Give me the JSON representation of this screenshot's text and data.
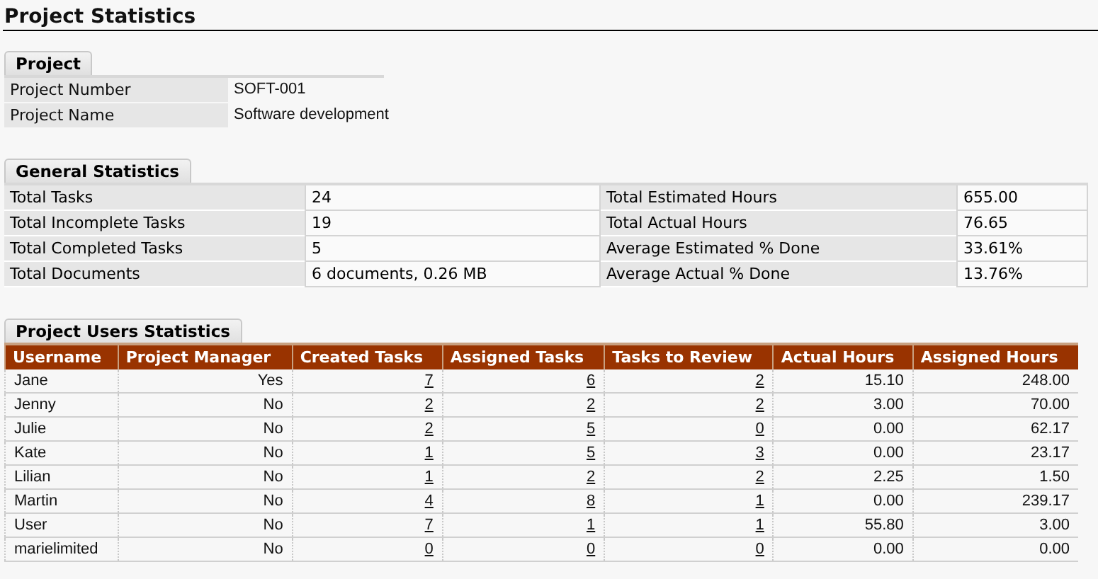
{
  "title": "Project Statistics",
  "project": {
    "tab": "Project",
    "rows": [
      {
        "label": "Project Number",
        "value": "SOFT-001"
      },
      {
        "label": "Project Name",
        "value": "Software development"
      }
    ]
  },
  "general": {
    "tab": "General Statistics",
    "rows": [
      {
        "label": "Total Tasks",
        "value": "24",
        "label_2": "Total Estimated Hours",
        "value_2": "655.00"
      },
      {
        "label": "Total Incomplete Tasks",
        "value": "19",
        "label_2": "Total Actual Hours",
        "value_2": "76.65"
      },
      {
        "label": "Total Completed Tasks",
        "value": "5",
        "label_2": "Average Estimated % Done",
        "value_2": "33.61%"
      },
      {
        "label": "Total Documents",
        "value": "6 documents, 0.26 MB",
        "label_2": "Average Actual % Done",
        "value_2": "13.76%"
      }
    ]
  },
  "users": {
    "tab": "Project Users Statistics",
    "columns": [
      {
        "label": "Username",
        "kind": "text"
      },
      {
        "label": "Project Manager",
        "kind": "flag"
      },
      {
        "label": "Created Tasks",
        "kind": "link"
      },
      {
        "label": "Assigned Tasks",
        "kind": "link"
      },
      {
        "label": "Tasks to Review",
        "kind": "link"
      },
      {
        "label": "Actual Hours",
        "kind": "number"
      },
      {
        "label": "Assigned Hours",
        "kind": "number"
      }
    ],
    "rows": [
      [
        "Jane",
        "Yes",
        "7",
        "6",
        "2",
        "15.10",
        "248.00"
      ],
      [
        "Jenny",
        "No",
        "2",
        "2",
        "2",
        "3.00",
        "70.00"
      ],
      [
        "Julie",
        "No",
        "2",
        "5",
        "0",
        "0.00",
        "62.17"
      ],
      [
        "Kate",
        "No",
        "1",
        "5",
        "3",
        "0.00",
        "23.17"
      ],
      [
        "Lilian",
        "No",
        "1",
        "2",
        "2",
        "2.25",
        "1.50"
      ],
      [
        "Martin",
        "No",
        "4",
        "8",
        "1",
        "0.00",
        "239.17"
      ],
      [
        "User",
        "No",
        "7",
        "1",
        "1",
        "55.80",
        "3.00"
      ],
      [
        "marielimited",
        "No",
        "0",
        "0",
        "0",
        "0.00",
        "0.00"
      ]
    ]
  }
}
